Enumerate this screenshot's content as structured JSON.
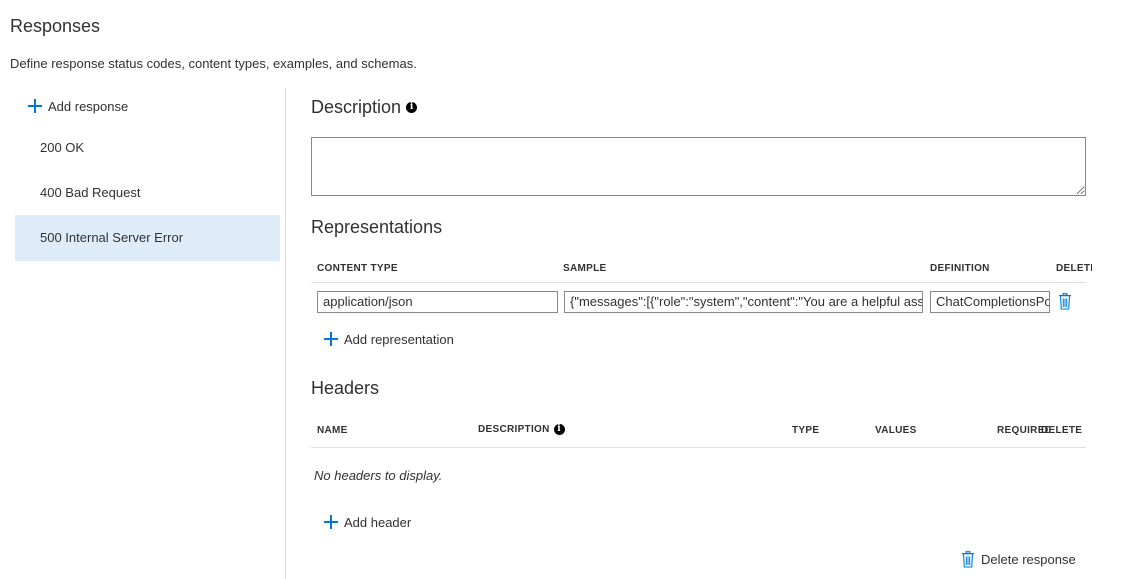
{
  "page": {
    "title": "Responses",
    "subtitle": "Define response status codes, content types, examples, and schemas."
  },
  "sidebar": {
    "add_label": "Add response",
    "items": [
      {
        "label": "200 OK",
        "selected": false
      },
      {
        "label": "400 Bad Request",
        "selected": false
      },
      {
        "label": "500 Internal Server Error",
        "selected": true
      }
    ]
  },
  "description": {
    "title": "Description",
    "info_icon": "info-icon",
    "value": ""
  },
  "representations": {
    "title": "Representations",
    "columns": {
      "content_type": "CONTENT TYPE",
      "sample": "SAMPLE",
      "definition": "DEFINITION",
      "delete": "DELETE"
    },
    "rows": [
      {
        "content_type": "application/json",
        "sample": "{\"messages\":[{\"role\":\"system\",\"content\":\"You are a helpful assi",
        "definition": "ChatCompletionsPo",
        "delete_icon": "trash-icon"
      }
    ],
    "add_label": "Add representation"
  },
  "headers": {
    "title": "Headers",
    "columns": {
      "name": "NAME",
      "description": "DESCRIPTION",
      "type": "TYPE",
      "values": "VALUES",
      "required": "REQUIRED",
      "delete": "DELETE"
    },
    "empty_text": "No headers to display.",
    "add_label": "Add header"
  },
  "footer": {
    "delete_response_label": "Delete response",
    "delete_icon": "trash-icon"
  },
  "colors": {
    "accent": "#0078d4",
    "selected_bg": "#deecf9",
    "border": "#8a8886",
    "divider": "#e1dfdd"
  }
}
